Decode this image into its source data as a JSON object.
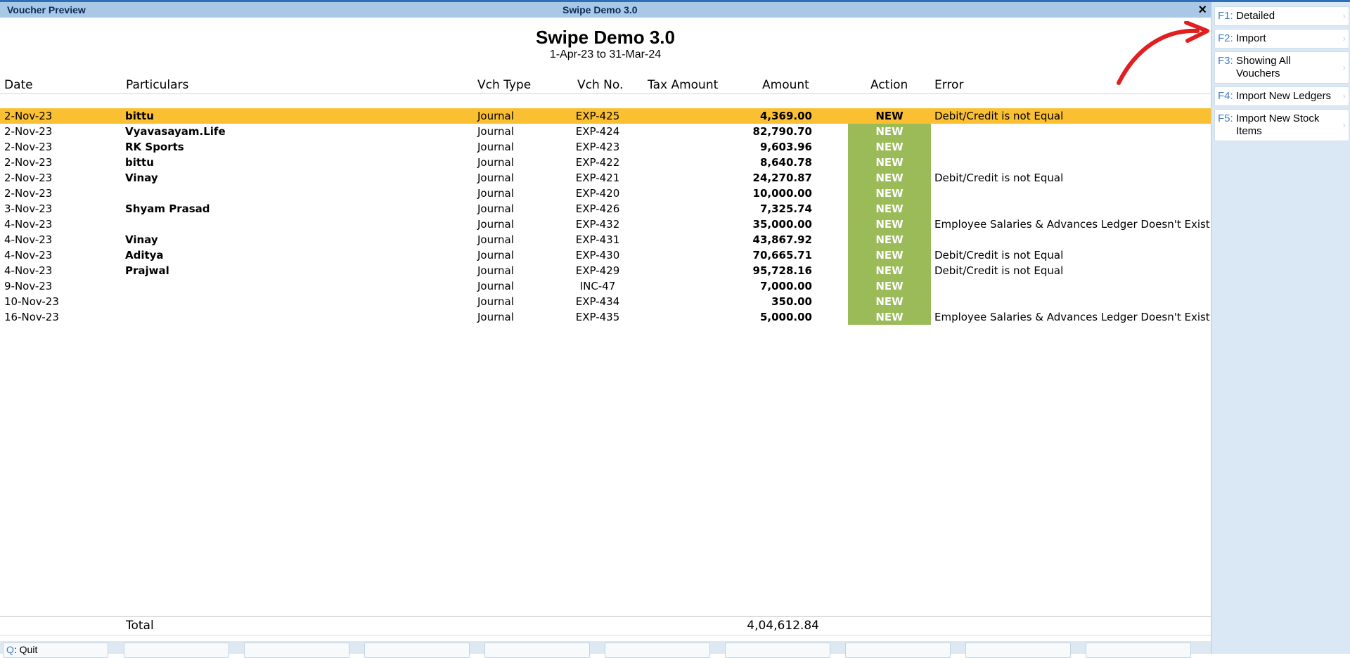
{
  "window": {
    "title_left": "Voucher Preview",
    "title_center": "Swipe Demo 3.0",
    "close": "×"
  },
  "report": {
    "company": "Swipe Demo 3.0",
    "period": "1-Apr-23 to 31-Mar-24"
  },
  "columns": {
    "date": "Date",
    "particulars": "Particulars",
    "vch_type": "Vch Type",
    "vch_no": "Vch No.",
    "tax_amount": "Tax Amount",
    "amount": "Amount",
    "action": "Action",
    "error": "Error"
  },
  "rows": [
    {
      "date": "2-Nov-23",
      "particulars": "bittu",
      "vch_type": "Journal",
      "vch_no": "EXP-425",
      "amount": "4,369.00",
      "action": "NEW",
      "error": "Debit/Credit is not Equal"
    },
    {
      "date": "2-Nov-23",
      "particulars": "Vyavasayam.Life",
      "vch_type": "Journal",
      "vch_no": "EXP-424",
      "amount": "82,790.70",
      "action": "NEW",
      "error": ""
    },
    {
      "date": "2-Nov-23",
      "particulars": "RK Sports",
      "vch_type": "Journal",
      "vch_no": "EXP-423",
      "amount": "9,603.96",
      "action": "NEW",
      "error": ""
    },
    {
      "date": "2-Nov-23",
      "particulars": "bittu",
      "vch_type": "Journal",
      "vch_no": "EXP-422",
      "amount": "8,640.78",
      "action": "NEW",
      "error": ""
    },
    {
      "date": "2-Nov-23",
      "particulars": "Vinay",
      "vch_type": "Journal",
      "vch_no": "EXP-421",
      "amount": "24,270.87",
      "action": "NEW",
      "error": "Debit/Credit is not Equal"
    },
    {
      "date": "2-Nov-23",
      "particulars": "",
      "vch_type": "Journal",
      "vch_no": "EXP-420",
      "amount": "10,000.00",
      "action": "NEW",
      "error": ""
    },
    {
      "date": "3-Nov-23",
      "particulars": "Shyam Prasad",
      "vch_type": "Journal",
      "vch_no": "EXP-426",
      "amount": "7,325.74",
      "action": "NEW",
      "error": ""
    },
    {
      "date": "4-Nov-23",
      "particulars": "",
      "vch_type": "Journal",
      "vch_no": "EXP-432",
      "amount": "35,000.00",
      "action": "NEW",
      "error": "Employee Salaries & Advances Ledger Doesn't Exist"
    },
    {
      "date": "4-Nov-23",
      "particulars": "Vinay",
      "vch_type": "Journal",
      "vch_no": "EXP-431",
      "amount": "43,867.92",
      "action": "NEW",
      "error": ""
    },
    {
      "date": "4-Nov-23",
      "particulars": "Aditya",
      "vch_type": "Journal",
      "vch_no": "EXP-430",
      "amount": "70,665.71",
      "action": "NEW",
      "error": "Debit/Credit is not Equal"
    },
    {
      "date": "4-Nov-23",
      "particulars": "Prajwal",
      "vch_type": "Journal",
      "vch_no": "EXP-429",
      "amount": "95,728.16",
      "action": "NEW",
      "error": "Debit/Credit is not Equal"
    },
    {
      "date": "9-Nov-23",
      "particulars": "",
      "vch_type": "Journal",
      "vch_no": "INC-47",
      "amount": "7,000.00",
      "action": "NEW",
      "error": ""
    },
    {
      "date": "10-Nov-23",
      "particulars": "",
      "vch_type": "Journal",
      "vch_no": "EXP-434",
      "amount": "350.00",
      "action": "NEW",
      "error": ""
    },
    {
      "date": "16-Nov-23",
      "particulars": "",
      "vch_type": "Journal",
      "vch_no": "EXP-435",
      "amount": "5,000.00",
      "action": "NEW",
      "error": "Employee Salaries & Advances Ledger Doesn't Exist"
    }
  ],
  "total": {
    "label": "Total",
    "amount": "4,04,612.84"
  },
  "bottom_bar": {
    "quit_key": "Q",
    "quit_label": "Quit"
  },
  "sidebar": [
    {
      "key": "F1",
      "label": "Detailed"
    },
    {
      "key": "F2",
      "label": "Import"
    },
    {
      "key": "F3",
      "label": "Showing All Vouchers"
    },
    {
      "key": "F4",
      "label": "Import New Ledgers"
    },
    {
      "key": "F5",
      "label": "Import New Stock Items"
    }
  ],
  "colors": {
    "selected_row": "#fbbf32",
    "new_action": "#9bbb59",
    "annotation_arrow": "#e02020"
  },
  "icons": {
    "close": "close-icon",
    "annotation": "red-curved-arrow-icon"
  }
}
